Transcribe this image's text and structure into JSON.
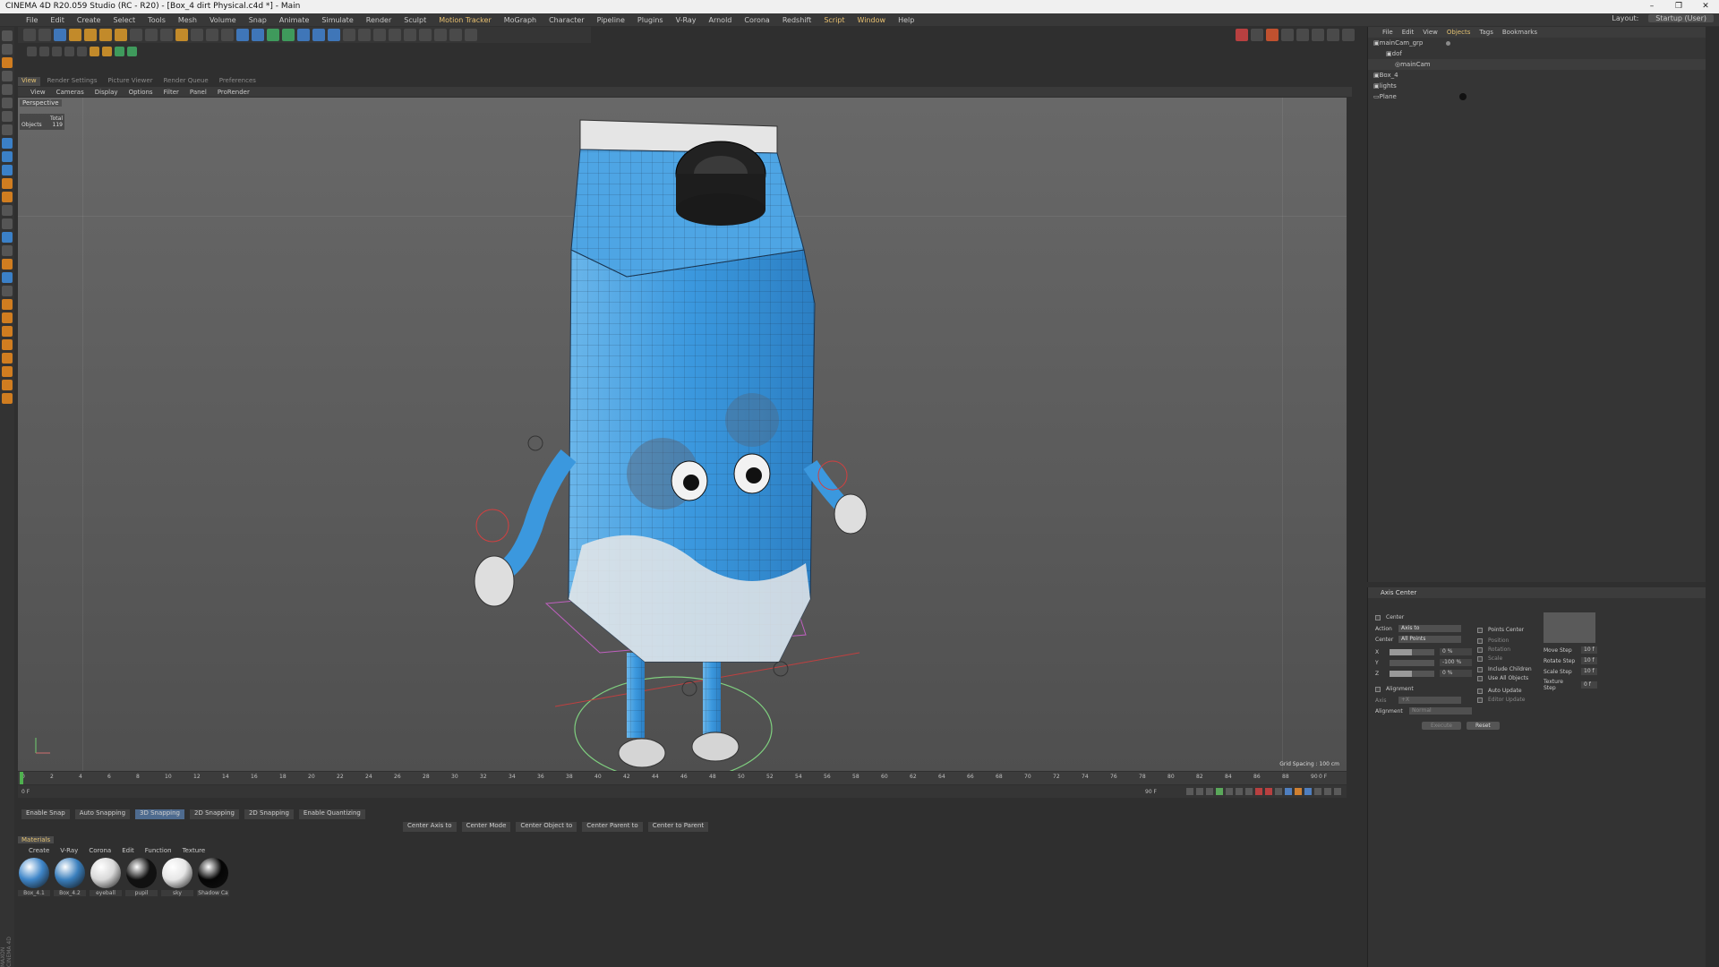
{
  "window": {
    "title": "CINEMA 4D R20.059 Studio (RC - R20) - [Box_4 dirt Physical.c4d *] - Main",
    "controls": [
      "–",
      "❐",
      "✕"
    ]
  },
  "menu": {
    "items": [
      "File",
      "Edit",
      "Create",
      "Select",
      "Tools",
      "Mesh",
      "Volume",
      "Snap",
      "Animate",
      "Simulate",
      "Render",
      "Sculpt",
      "Motion Tracker",
      "MoGraph",
      "Character",
      "Pipeline",
      "Plugins",
      "V-Ray",
      "Arnold",
      "Corona",
      "Redshift",
      "Script",
      "Window",
      "Help"
    ],
    "layout_label": "Layout:",
    "layout_value": "Startup (User)"
  },
  "view_tabs": [
    "View",
    "Render Settings",
    "Picture Viewer",
    "Render Queue",
    "Preferences"
  ],
  "view_menu": [
    "View",
    "Cameras",
    "Display",
    "Options",
    "Filter",
    "Panel",
    "ProRender"
  ],
  "viewport": {
    "label": "Perspective",
    "hud_total": "Total",
    "hud_objects_label": "Objects",
    "hud_objects_value": "119",
    "grid_spacing": "Grid Spacing : 100 cm"
  },
  "timeline": {
    "ticks": [
      "0",
      "2",
      "4",
      "6",
      "8",
      "10",
      "12",
      "14",
      "16",
      "18",
      "20",
      "22",
      "24",
      "26",
      "28",
      "30",
      "32",
      "34",
      "36",
      "38",
      "40",
      "42",
      "44",
      "46",
      "48",
      "50",
      "52",
      "54",
      "56",
      "58",
      "60",
      "62",
      "64",
      "66",
      "68",
      "70",
      "72",
      "74",
      "76",
      "78",
      "80",
      "82",
      "84",
      "86",
      "88",
      "90"
    ],
    "frame_end": "0 F",
    "current_frame": "0 F",
    "end_frame": "90 F"
  },
  "snapping": {
    "items": [
      "Enable Snap",
      "Auto Snapping",
      "3D Snapping",
      "2D Snapping",
      "2D Snapping",
      "Enable Quantizing"
    ],
    "actions": [
      "Center Axis to",
      "Center Mode",
      "Center Object to",
      "Center Parent to",
      "Center to Parent"
    ]
  },
  "materials": {
    "tab": "Materials",
    "menu": [
      "Create",
      "V-Ray",
      "Corona",
      "Edit",
      "Function",
      "Texture"
    ],
    "items": [
      {
        "name": "Box_4.1",
        "color": "#3f86c9"
      },
      {
        "name": "Box_4.2",
        "color": "#3a7fbd"
      },
      {
        "name": "eyeball",
        "color": "#d8d8d8"
      },
      {
        "name": "pupil",
        "color": "#111111"
      },
      {
        "name": "sky",
        "color": "#e6e6e6"
      },
      {
        "name": "Shadow Ca",
        "color": "#050505"
      }
    ]
  },
  "objects": {
    "menu": [
      "File",
      "Edit",
      "View",
      "Objects",
      "Tags",
      "Bookmarks"
    ],
    "rows": [
      "mainCam_grp",
      "dof",
      "mainCam",
      "Box_4",
      "lights",
      "Plane"
    ]
  },
  "attributes": {
    "title": "Axis Center",
    "center_label": "Center",
    "action_label": "Action",
    "action_value": "Axis to",
    "center_mode_label": "Center",
    "center_mode_value": "All Points",
    "x_label": "X",
    "x_value": "0 %",
    "y_label": "Y",
    "y_value": "-100 %",
    "z_label": "Z",
    "z_value": "0 %",
    "x_fill": 0.5,
    "y_fill": 0.0,
    "z_fill": 0.5,
    "points_center": "Points Center",
    "position": "Position",
    "rotation": "Rotation",
    "scale": "Scale",
    "include_children": "Include Children",
    "use_all_objects": "Use All Objects",
    "alignment_label": "Alignment",
    "axis_label": "Axis",
    "axis_value": "+X",
    "alignment_mode_label": "Alignment",
    "alignment_mode_value": "Normal",
    "auto_update": "Auto Update",
    "editor_update": "Editor Update",
    "execute": "Execute",
    "reset": "Reset",
    "move_step_label": "Move Step",
    "move_step_value": "10 f",
    "rotate_step_label": "Rotate Step",
    "rotate_step_value": "10 f",
    "scale_step_label": "Scale Step",
    "scale_step_value": "10 f",
    "texture_step_label": "Texture Step",
    "texture_step_value": "0 f"
  },
  "brand": "MAXON CINEMA 4D"
}
